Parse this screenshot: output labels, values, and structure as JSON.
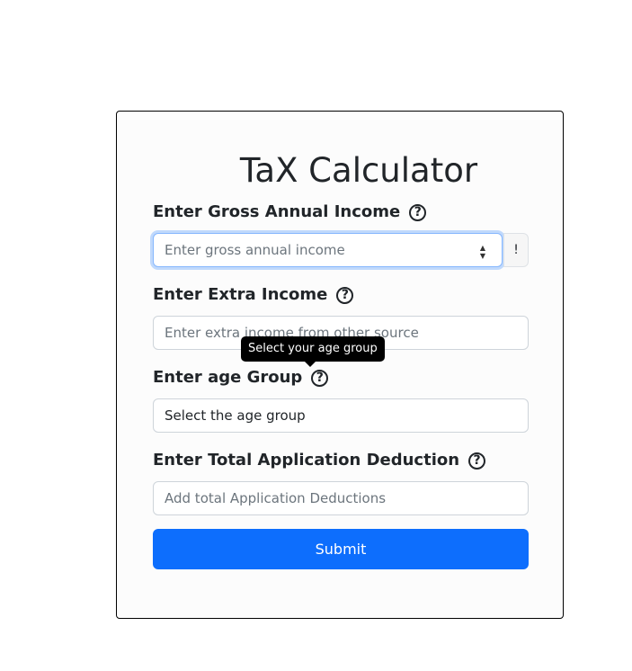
{
  "form": {
    "title": "TaX Calculator",
    "gross_income": {
      "label": "Enter Gross Annual Income",
      "placeholder": "Enter gross annual income",
      "help_glyph": "?",
      "addon_text": "!"
    },
    "extra_income": {
      "label": "Enter Extra Income",
      "placeholder": "Enter extra income from other source",
      "help_glyph": "?"
    },
    "age_group": {
      "label": "Enter age Group",
      "selected_value": "Select the age group",
      "help_glyph": "?",
      "tooltip": "Select your age group"
    },
    "deduction": {
      "label": "Enter Total Application Deduction",
      "placeholder": "Add total Application Deductions",
      "help_glyph": "?"
    },
    "submit_label": "Submit"
  },
  "colors": {
    "primary": "#0d6efd",
    "focus_border": "#86b7fe",
    "tooltip_bg": "#000000",
    "card_border": "#000000"
  }
}
